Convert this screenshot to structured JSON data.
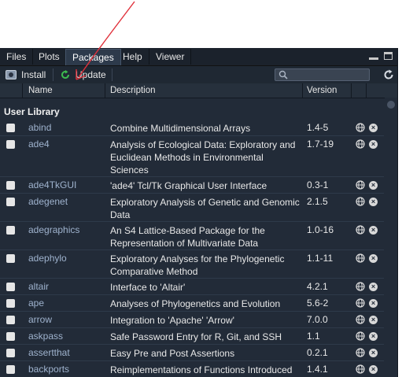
{
  "tabs": [
    {
      "label": "Files",
      "active": false
    },
    {
      "label": "Plots",
      "active": false
    },
    {
      "label": "Packages",
      "active": true
    },
    {
      "label": "Help",
      "active": false
    },
    {
      "label": "Viewer",
      "active": false
    }
  ],
  "toolbar": {
    "install_label": "Install",
    "update_label": "Update",
    "search_placeholder": ""
  },
  "columns": {
    "name": "Name",
    "description": "Description",
    "version": "Version"
  },
  "section_label": "User Library",
  "packages": [
    {
      "name": "abind",
      "description": "Combine Multidimensional Arrays",
      "version": "1.4-5",
      "lines": 1
    },
    {
      "name": "ade4",
      "description": "Analysis of Ecological Data: Exploratory and Euclidean Methods in Environmental Sciences",
      "version": "1.7-19",
      "lines": 3
    },
    {
      "name": "ade4TkGUI",
      "description": "'ade4' Tcl/Tk Graphical User Interface",
      "version": "0.3-1",
      "lines": 1
    },
    {
      "name": "adegenet",
      "description": "Exploratory Analysis of Genetic and Genomic Data",
      "version": "2.1.5",
      "lines": 2
    },
    {
      "name": "adegraphics",
      "description": "An S4 Lattice-Based Package for the Representation of Multivariate Data",
      "version": "1.0-16",
      "lines": 2
    },
    {
      "name": "adephylo",
      "description": "Exploratory Analyses for the Phylogenetic Comparative Method",
      "version": "1.1-11",
      "lines": 2
    },
    {
      "name": "altair",
      "description": "Interface to 'Altair'",
      "version": "4.2.1",
      "lines": 1
    },
    {
      "name": "ape",
      "description": "Analyses of Phylogenetics and Evolution",
      "version": "5.6-2",
      "lines": 1
    },
    {
      "name": "arrow",
      "description": "Integration to 'Apache' 'Arrow'",
      "version": "7.0.0",
      "lines": 1
    },
    {
      "name": "askpass",
      "description": "Safe Password Entry for R, Git, and SSH",
      "version": "1.1",
      "lines": 1
    },
    {
      "name": "assertthat",
      "description": "Easy Pre and Post Assertions",
      "version": "0.2.1",
      "lines": 1
    },
    {
      "name": "backports",
      "description": "Reimplementations of Functions Introduced",
      "version": "1.4.1",
      "lines": 1
    }
  ],
  "colors": {
    "pane_bg": "#222b38",
    "package_name": "#9fb3ce",
    "annotation_arrow": "#e0303a"
  }
}
